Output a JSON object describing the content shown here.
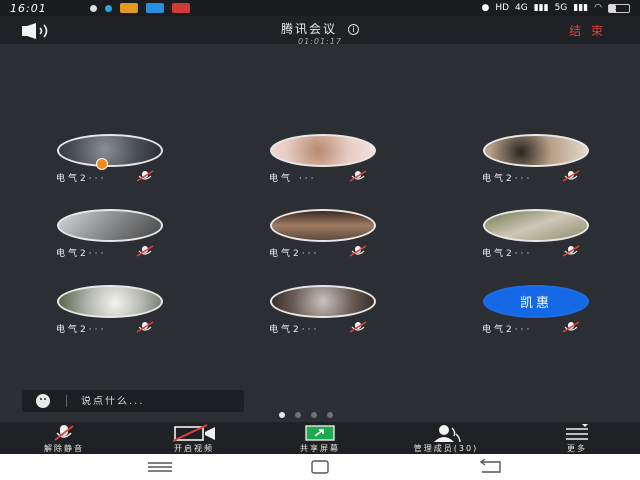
{
  "status_bar": {
    "time": "16:01",
    "network_labels": [
      "HD",
      "4G",
      "5G"
    ],
    "battery": "37"
  },
  "header": {
    "title": "腾讯会议",
    "elapsed": "01:01:17",
    "end_label": "结 束"
  },
  "participants": [
    {
      "name": "电气2···",
      "avatar": "photo",
      "is_host": true
    },
    {
      "name": "电气 ···",
      "avatar": "photo"
    },
    {
      "name": "电气2···",
      "avatar": "photo"
    },
    {
      "name": "电气2···",
      "avatar": "photo"
    },
    {
      "name": "电气2···",
      "avatar": "photo"
    },
    {
      "name": "电气2···",
      "avatar": "photo"
    },
    {
      "name": "电气2···",
      "avatar": "photo"
    },
    {
      "name": "电气2···",
      "avatar": "photo"
    },
    {
      "name": "电气2···",
      "avatar": "text",
      "avatar_text": "凯惠"
    }
  ],
  "chat": {
    "placeholder": "说点什么..."
  },
  "pager": {
    "pages": 4,
    "current": 1
  },
  "toolbar": {
    "unmute": "解除静音",
    "video": "开启视频",
    "share": "共享屏幕",
    "members": "管理成员(30)",
    "more": "更多"
  },
  "colors": {
    "accent_blue": "#1468e6",
    "end_red": "#e0413b",
    "background": "#2b2e32",
    "bar": "#1f2124"
  }
}
